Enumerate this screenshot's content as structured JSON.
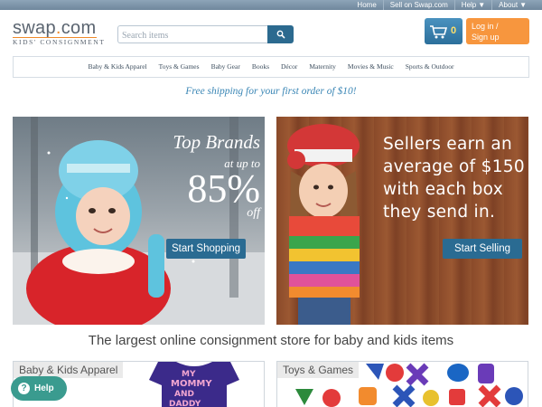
{
  "topbar": {
    "links": [
      "Home",
      "Sell on Swap.com",
      "Help",
      "About"
    ]
  },
  "logo": {
    "main": "swap",
    "dot": ".",
    "tld": "com",
    "sub": "KIDS' CONSIGNMENT"
  },
  "search": {
    "placeholder": "Search items",
    "value": ""
  },
  "cart": {
    "count": "0"
  },
  "login": {
    "line1": "Log in /",
    "line2": "Sign up"
  },
  "nav": {
    "items": [
      "Baby & Kids Apparel",
      "Toys & Games",
      "Baby Gear",
      "Books",
      "Décor",
      "Maternity",
      "Movies & Music",
      "Sports & Outdoor"
    ]
  },
  "promo": "Free shipping for your first order of $10!",
  "banner_left": {
    "line1": "Top Brands",
    "line2": "at up to",
    "big": "85%",
    "off": "off",
    "cta": "Start Shopping"
  },
  "banner_right": {
    "lines": [
      "Sellers earn an",
      "average of $150",
      "with each box",
      "they send in."
    ],
    "cta": "Start Selling"
  },
  "tagline": "The largest online consignment store for baby and kids items",
  "categories": [
    {
      "label": "Baby & Kids Apparel"
    },
    {
      "label": "Toys & Games"
    }
  ],
  "shirt_text": [
    "MY",
    "MOMMY",
    "AND",
    "DADDY"
  ],
  "help": {
    "label": "Help"
  },
  "colors": {
    "accent": "#2a6b92",
    "orange": "#f7963e",
    "promo": "#3a86b5",
    "help": "#3a9b8f"
  }
}
